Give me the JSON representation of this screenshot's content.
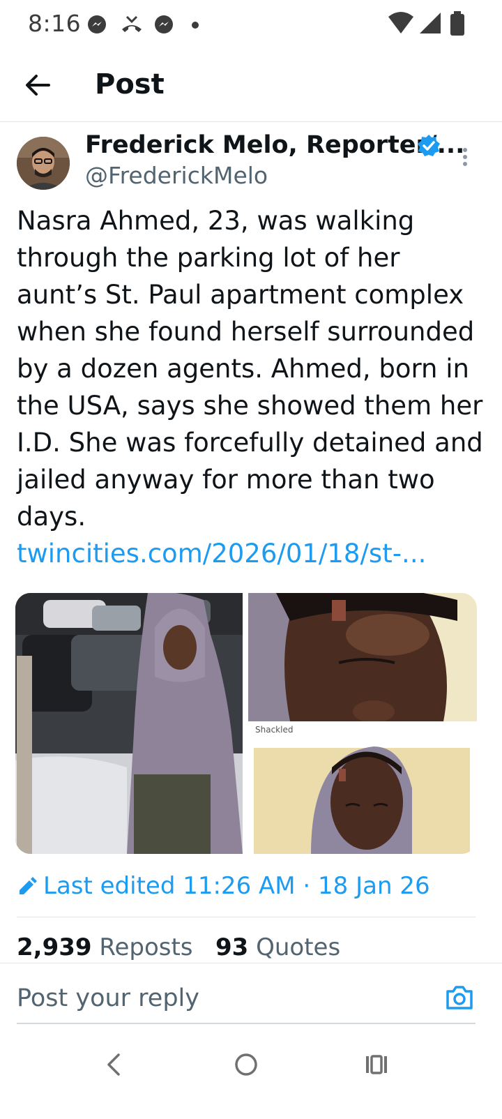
{
  "status_bar": {
    "time": "8:16",
    "left_icons": [
      "messenger-icon",
      "missed-call-icon",
      "messenger-icon",
      "dot-icon"
    ],
    "right_icons": [
      "wifi-icon",
      "signal-icon",
      "battery-icon"
    ]
  },
  "header": {
    "title": "Post"
  },
  "post": {
    "author_name": "Frederick Melo, Reporter/...",
    "handle": "@FrederickMelo",
    "text": "Nasra Ahmed, 23, was walking through the parking lot of her aunt’s St. Paul apartment complex when she found herself surrounded by a dozen agents. Ahmed, born in the USA, says she showed them her I.D. She was forcefully detained and jailed anyway for more than two days. ",
    "link": "twincities.com/2026/01/18/st-...",
    "media_caption_partial": "Shackled",
    "edited_label": "Last edited 11:26 AM · 18 Jan 26"
  },
  "stats": {
    "reposts_count": "2,939",
    "reposts_label": "Reposts",
    "quotes_count": "93",
    "quotes_label": "Quotes"
  },
  "reply": {
    "placeholder": "Post your reply"
  },
  "colors": {
    "accent": "#1d9bf0",
    "text_primary": "#0f1419",
    "text_secondary": "#536471"
  }
}
